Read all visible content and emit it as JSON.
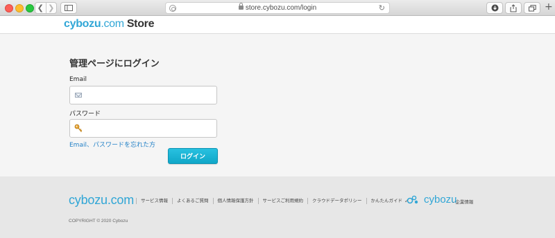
{
  "browser": {
    "url": "store.cybozu.com/login"
  },
  "header": {
    "logo_main": "cybozu",
    "logo_dot": ".com",
    "logo_store": "Store"
  },
  "login": {
    "title": "管理ページにログイン",
    "email_label": "Email",
    "email_value": "",
    "password_label": "パスワード",
    "password_value": "",
    "forgot_link": "Email、パスワードを忘れた方",
    "login_button": "ログイン"
  },
  "footer": {
    "logo": "cybozu.com",
    "links": [
      "サービス情報",
      "よくあるご質問",
      "個人情報保護方針",
      "サービスご利用規約",
      "クラウドデータポリシー",
      "かんたんガイド"
    ],
    "brand": "cybozu",
    "corp_link": "- 企業情報",
    "copyright": "COPYRIGHT © 2020 Cybozu"
  },
  "colors": {
    "brand": "#30a6d6",
    "login_button": "#1ab4d6",
    "link": "#1f7fc6"
  },
  "icons": [
    "back-icon",
    "forward-icon",
    "sidebar-icon",
    "lock-icon",
    "reload-icon",
    "download-icon",
    "share-icon",
    "tabs-icon",
    "new-tab-icon",
    "mail-icon",
    "key-icon"
  ]
}
